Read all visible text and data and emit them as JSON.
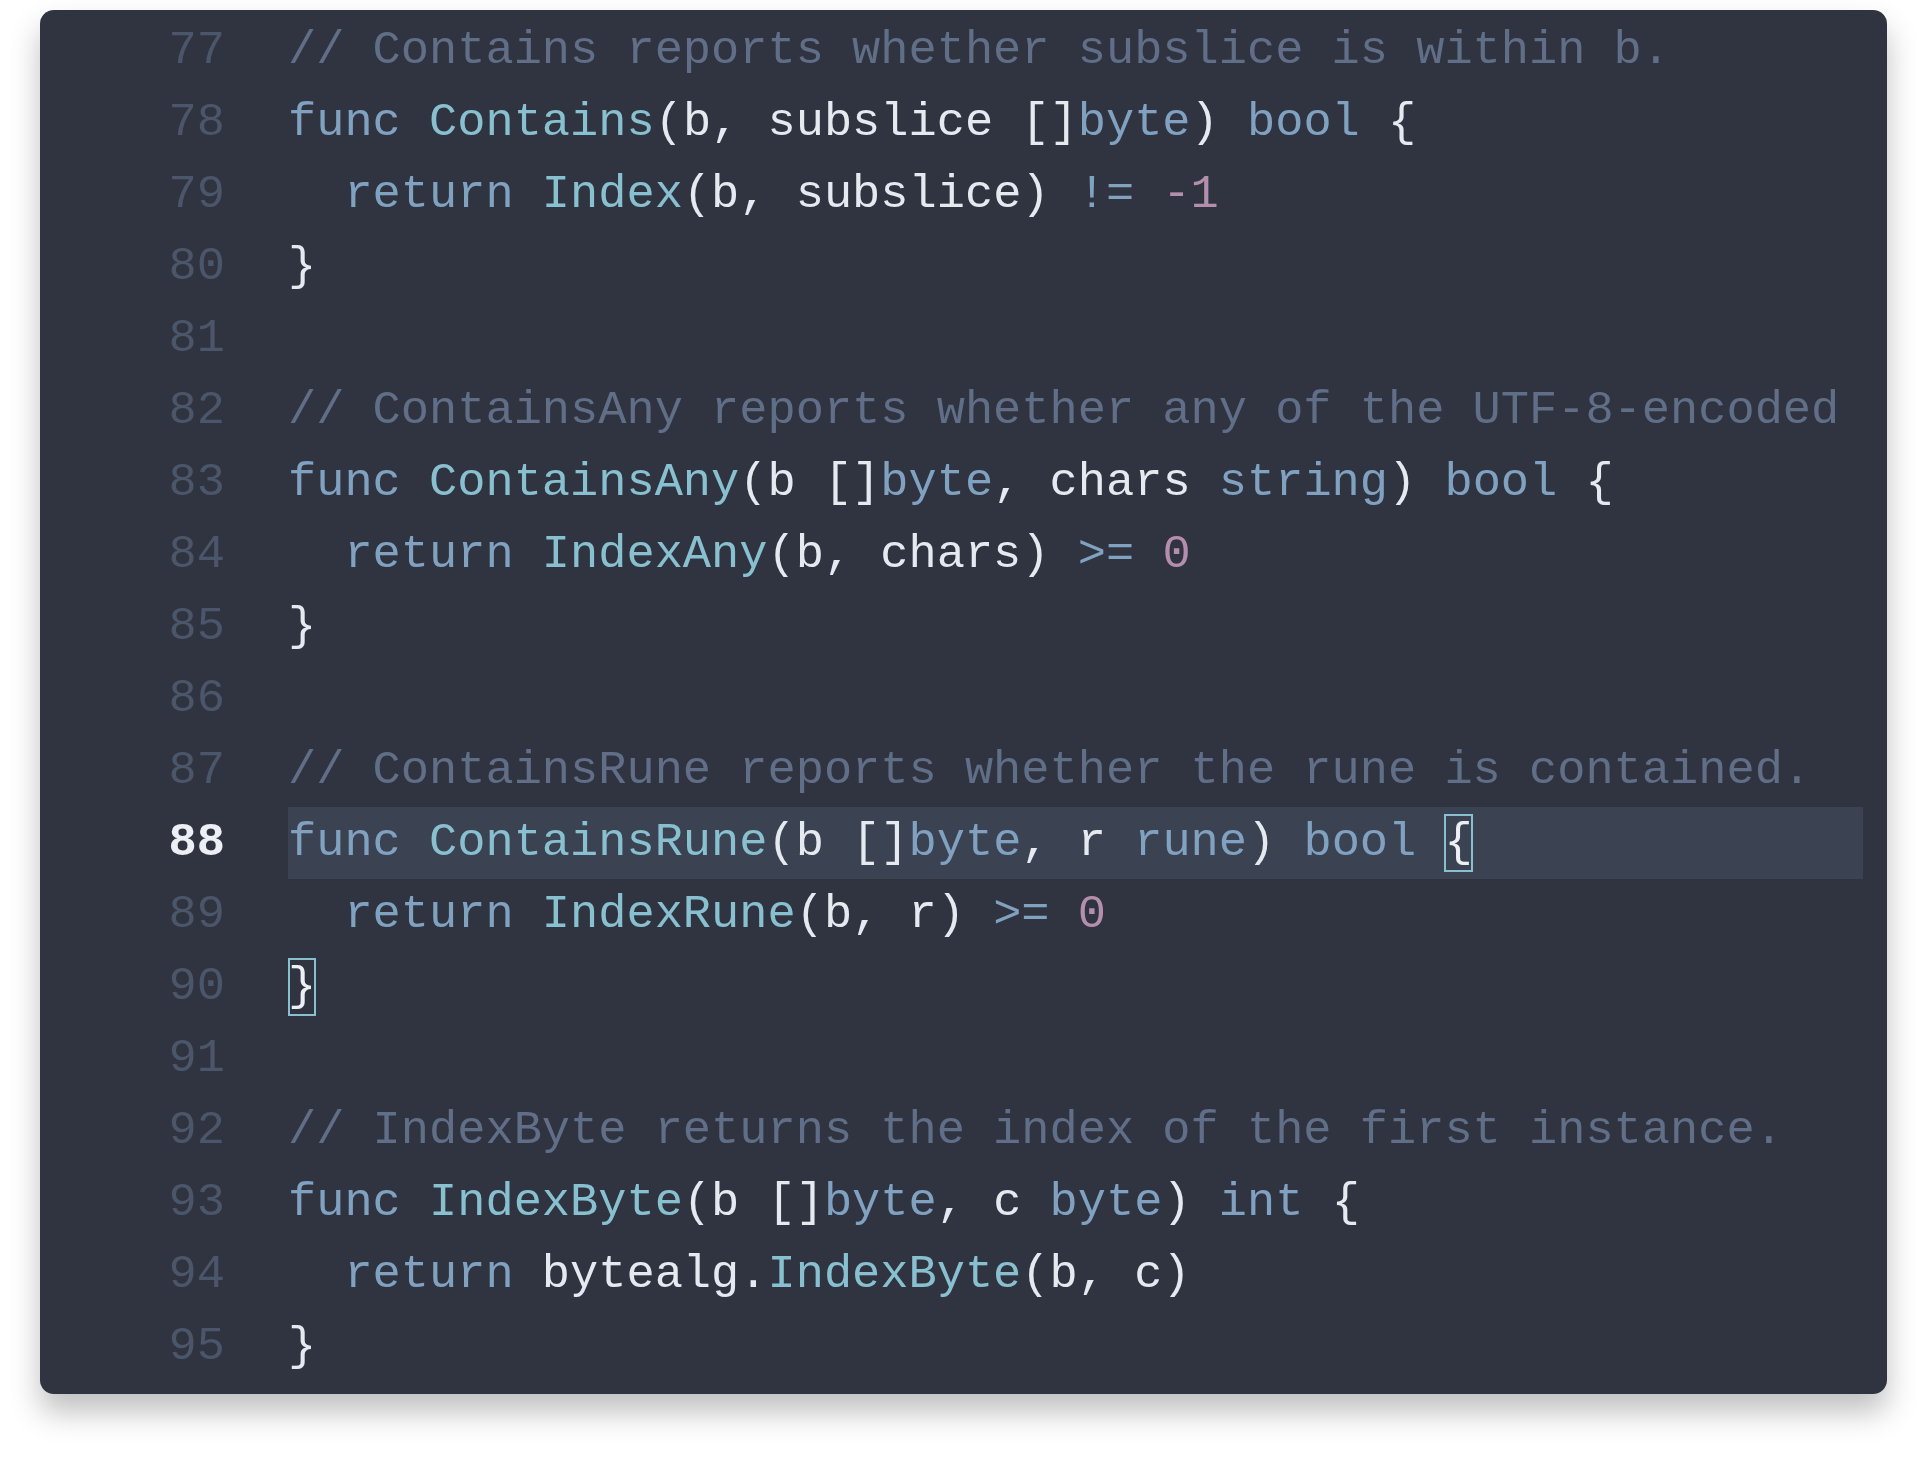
{
  "editor": {
    "lines": [
      {
        "number": "77",
        "current": false,
        "tokens": [
          {
            "text": "// Contains reports whether subslice is within b.",
            "kind": "comment"
          }
        ]
      },
      {
        "number": "78",
        "current": false,
        "tokens": [
          {
            "text": "func ",
            "kind": "keyword"
          },
          {
            "text": "Contains",
            "kind": "function"
          },
          {
            "text": "(b, subslice []",
            "kind": "text"
          },
          {
            "text": "byte",
            "kind": "type"
          },
          {
            "text": ") ",
            "kind": "text"
          },
          {
            "text": "bool",
            "kind": "type"
          },
          {
            "text": " {",
            "kind": "text"
          }
        ]
      },
      {
        "number": "79",
        "current": false,
        "tokens": [
          {
            "text": "  return ",
            "kind": "keyword"
          },
          {
            "text": "Index",
            "kind": "function"
          },
          {
            "text": "(b, subslice) ",
            "kind": "text"
          },
          {
            "text": "!= ",
            "kind": "operator"
          },
          {
            "text": "-1",
            "kind": "number"
          }
        ]
      },
      {
        "number": "80",
        "current": false,
        "tokens": [
          {
            "text": "}",
            "kind": "text"
          }
        ]
      },
      {
        "number": "81",
        "current": false
      },
      {
        "number": "82",
        "current": false,
        "tokens": [
          {
            "text": "// ContainsAny reports whether any of the UTF-8-encoded",
            "kind": "comment"
          }
        ]
      },
      {
        "number": "83",
        "current": false,
        "tokens": [
          {
            "text": "func ",
            "kind": "keyword"
          },
          {
            "text": "ContainsAny",
            "kind": "function"
          },
          {
            "text": "(b []",
            "kind": "text"
          },
          {
            "text": "byte",
            "kind": "type"
          },
          {
            "text": ", chars ",
            "kind": "text"
          },
          {
            "text": "string",
            "kind": "type"
          },
          {
            "text": ") ",
            "kind": "text"
          },
          {
            "text": "bool",
            "kind": "type"
          },
          {
            "text": " {",
            "kind": "text"
          }
        ]
      },
      {
        "number": "84",
        "current": false,
        "tokens": [
          {
            "text": "  return ",
            "kind": "keyword"
          },
          {
            "text": "IndexAny",
            "kind": "function"
          },
          {
            "text": "(b, chars) ",
            "kind": "text"
          },
          {
            "text": ">= ",
            "kind": "operator"
          },
          {
            "text": "0",
            "kind": "number"
          }
        ]
      },
      {
        "number": "85",
        "current": false,
        "tokens": [
          {
            "text": "}",
            "kind": "text"
          }
        ]
      },
      {
        "number": "86",
        "current": false
      },
      {
        "number": "87",
        "current": false,
        "tokens": [
          {
            "text": "// ContainsRune reports whether the rune is contained.",
            "kind": "comment"
          }
        ]
      },
      {
        "number": "88",
        "current": true,
        "tokens": [
          {
            "text": "func ",
            "kind": "keyword"
          },
          {
            "text": "ContainsRune",
            "kind": "function"
          },
          {
            "text": "(b []",
            "kind": "text"
          },
          {
            "text": "byte",
            "kind": "type"
          },
          {
            "text": ", r ",
            "kind": "text"
          },
          {
            "text": "rune",
            "kind": "type"
          },
          {
            "text": ") ",
            "kind": "text"
          },
          {
            "text": "bool ",
            "kind": "type"
          },
          {
            "text": "{",
            "kind": "matched_brace"
          }
        ]
      },
      {
        "number": "89",
        "current": false,
        "tokens": [
          {
            "text": "  return ",
            "kind": "keyword"
          },
          {
            "text": "IndexRune",
            "kind": "function"
          },
          {
            "text": "(b, r) ",
            "kind": "text"
          },
          {
            "text": ">= ",
            "kind": "operator"
          },
          {
            "text": "0",
            "kind": "number"
          }
        ]
      },
      {
        "number": "90",
        "current": false,
        "tokens": [
          {
            "text": "}",
            "kind": "matched_brace"
          }
        ]
      },
      {
        "number": "91",
        "current": false
      },
      {
        "number": "92",
        "current": false,
        "tokens": [
          {
            "text": "// IndexByte returns the index of the first instance.",
            "kind": "comment"
          }
        ]
      },
      {
        "number": "93",
        "current": false,
        "tokens": [
          {
            "text": "func ",
            "kind": "keyword"
          },
          {
            "text": "IndexByte",
            "kind": "function"
          },
          {
            "text": "(b []",
            "kind": "text"
          },
          {
            "text": "byte",
            "kind": "type"
          },
          {
            "text": ", c ",
            "kind": "text"
          },
          {
            "text": "byte",
            "kind": "type"
          },
          {
            "text": ") ",
            "kind": "text"
          },
          {
            "text": "int",
            "kind": "type"
          },
          {
            "text": " {",
            "kind": "text"
          }
        ]
      },
      {
        "number": "94",
        "current": false,
        "tokens": [
          {
            "text": "  return ",
            "kind": "keyword"
          },
          {
            "text": "bytealg.",
            "kind": "text"
          },
          {
            "text": "IndexByte",
            "kind": "function"
          },
          {
            "text": "(b, c)",
            "kind": "text"
          }
        ]
      },
      {
        "number": "95",
        "current": false,
        "tokens": [
          {
            "text": "}",
            "kind": "text"
          }
        ]
      }
    ]
  }
}
